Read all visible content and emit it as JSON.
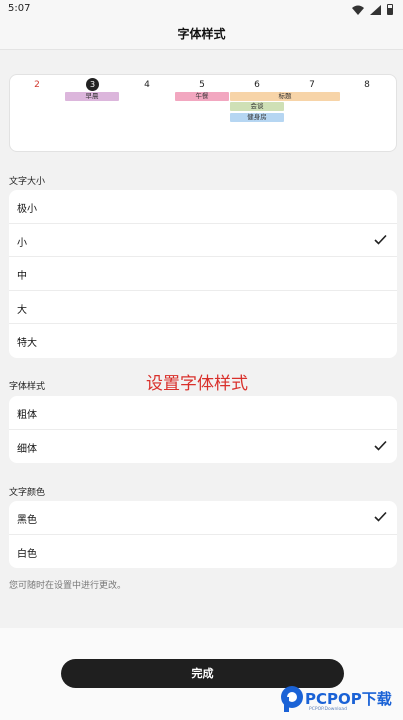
{
  "status_bar": {
    "time": "5:07"
  },
  "header": {
    "title": "字体样式"
  },
  "calendar": {
    "days": [
      "2",
      "3",
      "4",
      "5",
      "6",
      "7",
      "8"
    ],
    "selected_day": "3",
    "events": [
      {
        "label": "早晨",
        "color": "#dcb6dc"
      },
      {
        "label": "午餐",
        "color": "#f2a7c0"
      },
      {
        "label": "标题",
        "color": "#f7d4a8"
      },
      {
        "label": "会谈",
        "color": "#cfe0b6"
      },
      {
        "label": "健身房",
        "color": "#b6d6f2"
      }
    ]
  },
  "font_size": {
    "label": "文字大小",
    "options": [
      "极小",
      "小",
      "中",
      "大",
      "特大"
    ],
    "selected": "小"
  },
  "overlay_title": "设置字体样式",
  "font_style": {
    "label": "字体样式",
    "options": [
      "粗体",
      "细体"
    ],
    "selected": "细体"
  },
  "text_color": {
    "label": "文字颜色",
    "options": [
      "黑色",
      "白色"
    ],
    "selected": "黑色"
  },
  "footnote": "您可随时在设置中进行更改。",
  "done_label": "完成",
  "watermark": {
    "text": "PCPOP下载",
    "sub": "PCPOP.Download"
  }
}
